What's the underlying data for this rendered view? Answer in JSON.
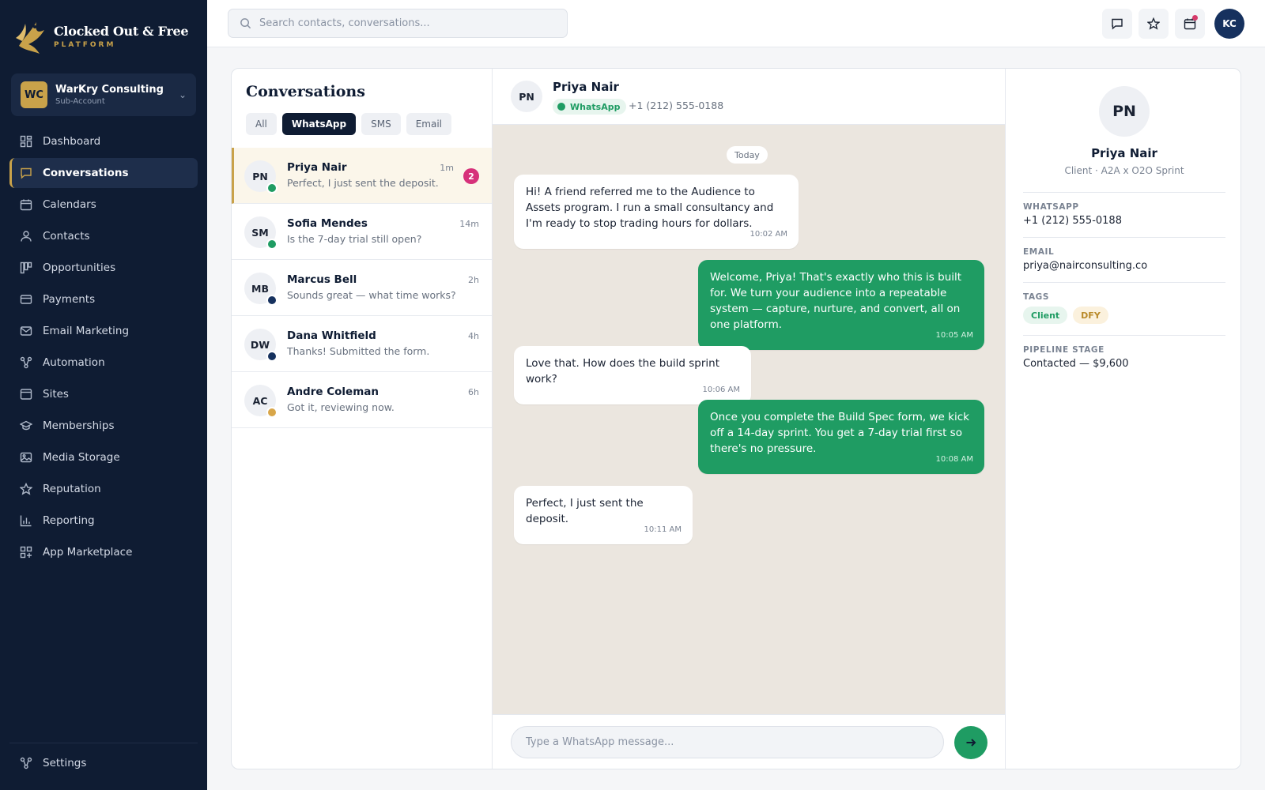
{
  "brand": {
    "name": "Clocked Out & Free",
    "subtitle": "PLATFORM"
  },
  "account": {
    "initials": "WC",
    "name": "WarKry Consulting",
    "role": "Sub-Account"
  },
  "nav": [
    {
      "label": "Dashboard",
      "icon": "dashboard-icon"
    },
    {
      "label": "Conversations",
      "icon": "chat-icon",
      "active": true
    },
    {
      "label": "Calendars",
      "icon": "calendar-icon"
    },
    {
      "label": "Contacts",
      "icon": "user-icon"
    },
    {
      "label": "Opportunities",
      "icon": "pipeline-icon"
    },
    {
      "label": "Payments",
      "icon": "card-icon"
    },
    {
      "label": "Email Marketing",
      "icon": "mail-icon"
    },
    {
      "label": "Automation",
      "icon": "automation-icon"
    },
    {
      "label": "Sites",
      "icon": "browser-icon"
    },
    {
      "label": "Memberships",
      "icon": "graduation-icon"
    },
    {
      "label": "Media Storage",
      "icon": "image-icon"
    },
    {
      "label": "Reputation",
      "icon": "star-icon"
    },
    {
      "label": "Reporting",
      "icon": "bar-chart-icon"
    },
    {
      "label": "App Marketplace",
      "icon": "apps-icon"
    }
  ],
  "settings": {
    "label": "Settings"
  },
  "topbar": {
    "search_placeholder": "Search contacts, conversations...",
    "user_initials": "KC"
  },
  "conversations": {
    "title": "Conversations",
    "filters": [
      "All",
      "WhatsApp",
      "SMS",
      "Email"
    ],
    "active_filter": 1,
    "threads": [
      {
        "initials": "PN",
        "name": "Priya Nair",
        "preview": "Perfect, I just sent the deposit.",
        "time": "1m",
        "unread": "2",
        "channel": "wa"
      },
      {
        "initials": "SM",
        "name": "Sofia Mendes",
        "preview": "Is the 7-day trial still open?",
        "time": "14m",
        "channel": "wa"
      },
      {
        "initials": "MB",
        "name": "Marcus Bell",
        "preview": "Sounds great — what time works?",
        "time": "2h",
        "channel": "sms"
      },
      {
        "initials": "DW",
        "name": "Dana Whitfield",
        "preview": "Thanks! Submitted the form.",
        "time": "4h",
        "channel": "sms"
      },
      {
        "initials": "AC",
        "name": "Andre Coleman",
        "preview": "Got it, reviewing now.",
        "time": "6h",
        "channel": "email"
      }
    ]
  },
  "chat": {
    "initials": "PN",
    "name": "Priya Nair",
    "channel": "WhatsApp",
    "phone": "+1 (212) 555-0188",
    "day": "Today",
    "messages": [
      {
        "dir": "in",
        "text": "Hi! A friend referred me to the Audience to Assets program. I run a small consultancy and I'm ready to stop trading hours for dollars.",
        "time": "10:02 AM"
      },
      {
        "dir": "out",
        "text": "Welcome, Priya! That's exactly who this is built for. We turn your audience into a repeatable system — capture, nurture, and convert, all on one platform.",
        "time": "10:05 AM"
      },
      {
        "dir": "in",
        "text": "Love that. How does the build sprint work?",
        "time": "10:06 AM"
      },
      {
        "dir": "out",
        "text": "Once you complete the Build Spec form, we kick off a 14-day sprint. You get a 7-day trial first so there's no pressure.",
        "time": "10:08 AM"
      },
      {
        "dir": "in",
        "text": "Perfect, I just sent the deposit.",
        "time": "10:11 AM"
      }
    ],
    "composer_placeholder": "Type a WhatsApp message..."
  },
  "profile": {
    "initials": "PN",
    "name": "Priya Nair",
    "subtitle": "Client · A2A x O2O Sprint",
    "whatsapp_label": "WHATSAPP",
    "whatsapp": "+1 (212) 555-0188",
    "email_label": "EMAIL",
    "email": "priya@nairconsulting.co",
    "tags_label": "TAGS",
    "tags": [
      "Client",
      "DFY"
    ],
    "stage_label": "PIPELINE STAGE",
    "stage": "Contacted — $9,600"
  },
  "colors": {
    "navy": "#0f1c33",
    "gold": "#c9a24a",
    "whatsapp_green": "#1f9c63",
    "unread_pink": "#d6317a"
  }
}
